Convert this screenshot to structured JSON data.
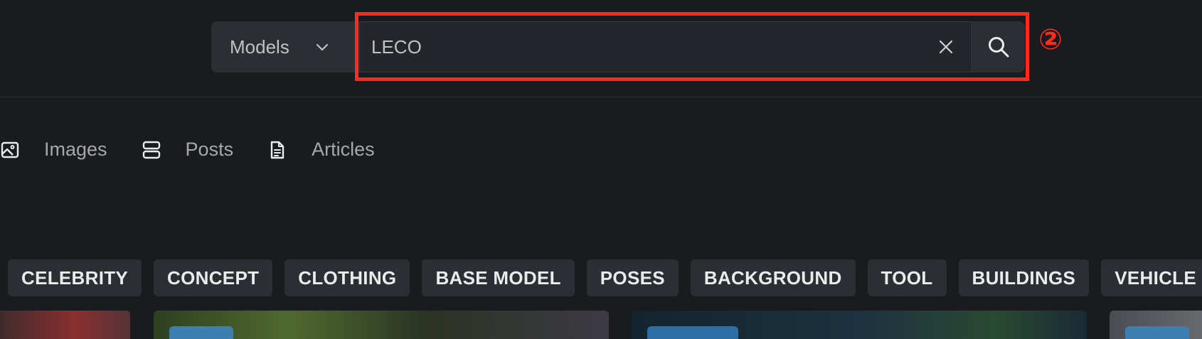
{
  "search": {
    "type_label": "Models",
    "query": "LECO",
    "step_marker": "②",
    "highlight_color": "#ff2a1a"
  },
  "nav": {
    "tabs": [
      {
        "label": "Images",
        "icon": "image-icon"
      },
      {
        "label": "Posts",
        "icon": "posts-icon"
      },
      {
        "label": "Articles",
        "icon": "article-icon"
      }
    ]
  },
  "chips": [
    "CELEBRITY",
    "CONCEPT",
    "CLOTHING",
    "BASE MODEL",
    "POSES",
    "BACKGROUND",
    "TOOL",
    "BUILDINGS",
    "VEHICLE"
  ]
}
